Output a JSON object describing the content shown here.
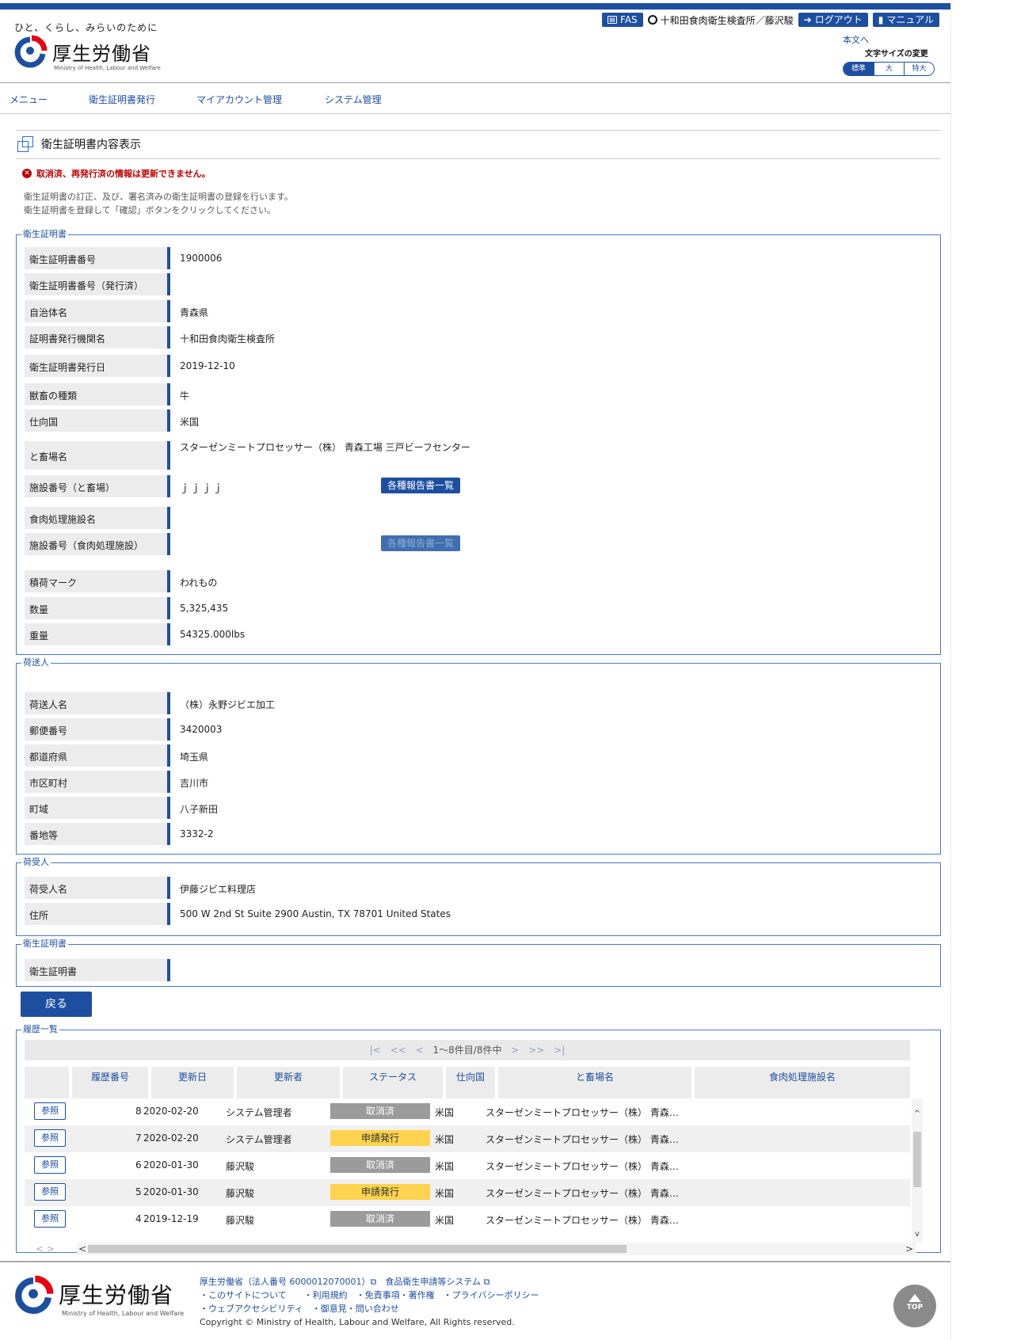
{
  "header": {
    "tagline": "ひと、くらし、みらいのために",
    "logo_name": "厚生労働省",
    "logo_en": "Ministry of Health, Labour and Welfare",
    "fas_label": "FAS",
    "user": "十和田食肉衛生検査所／藤沢駿",
    "logout_label": "ログアウト",
    "manual_label": "マニュアル",
    "skip_link": "本文へ",
    "font_size_label": "文字サイズの変更",
    "font_sizes": [
      "標準",
      "大",
      "特大"
    ]
  },
  "nav": [
    "メニュー",
    "衛生証明書発行",
    "マイアカウント管理",
    "システム管理"
  ],
  "page": {
    "title": "衛生証明書内容表示",
    "error": "取消済、再発行済の情報は更新できません。",
    "desc_1": "衛生証明書の訂正、及び、署名済みの衛生証明書の登録を行います。",
    "desc_2": "衛生証明書を登録して「確認」ボタンをクリックしてください。"
  },
  "cert": {
    "legend": "衛生証明書",
    "rows": [
      {
        "label": "衛生証明書番号",
        "value": "1900006"
      },
      {
        "label": "衛生証明書番号（発行済）",
        "value": ""
      },
      {
        "label": "自治体名",
        "value": "青森県"
      },
      {
        "label": "証明書発行機関名",
        "value": "十和田食肉衛生検査所"
      },
      {
        "label": "衛生証明書発行日",
        "value": "2019-12-10"
      },
      {
        "label": "獣畜の種類",
        "value": "牛"
      },
      {
        "label": "仕向国",
        "value": "米国"
      },
      {
        "label": "と畜場名",
        "value": "スターゼンミートプロセッサー（株） 青森工場 三戸ビーフセンター"
      },
      {
        "label": "施設番号（と畜場）",
        "value": "ｊｊｊｊ"
      },
      {
        "label": "食肉処理施設名",
        "value": ""
      },
      {
        "label": "施設番号（食肉処理施設）",
        "value": ""
      },
      {
        "label": "積荷マーク",
        "value": "われもの"
      },
      {
        "label": "数量",
        "value": "5,325,435"
      },
      {
        "label": "重量",
        "value": "54325.000lbs"
      }
    ],
    "report_btn": "各種報告書一覧"
  },
  "shipper": {
    "legend": "荷送人",
    "rows": [
      {
        "label": "荷送人名",
        "value": "（株）永野ジビエ加工"
      },
      {
        "label": "郵便番号",
        "value": "3420003"
      },
      {
        "label": "都道府県",
        "value": "埼玉県"
      },
      {
        "label": "市区町村",
        "value": "吉川市"
      },
      {
        "label": "町域",
        "value": "八子新田"
      },
      {
        "label": "番地等",
        "value": "3332-2"
      }
    ]
  },
  "consignee": {
    "legend": "荷受人",
    "rows": [
      {
        "label": "荷受人名",
        "value": "伊藤ジビエ料理店"
      },
      {
        "label": "住所",
        "value": "500 W 2nd St Suite 2900 Austin, TX 78701 United States"
      }
    ]
  },
  "cert_file": {
    "legend": "衛生証明書",
    "rows": [
      {
        "label": "衛生証明書",
        "value": ""
      }
    ]
  },
  "back_label": "戻る",
  "history": {
    "legend": "履歴一覧",
    "pager": {
      "first": "|<",
      "prev2": "<<",
      "prev": "<",
      "info": "1〜8件目/8件中",
      "next": ">",
      "next2": ">>",
      "last": ">|"
    },
    "columns": [
      "履歴番号",
      "更新日",
      "更新者",
      "ステータス",
      "仕向国",
      "と畜場名",
      "食肉処理施設名"
    ],
    "ref_label": "参照",
    "rows": [
      {
        "no": "8",
        "date": "2020-02-20",
        "user": "システム管理者",
        "status": "取消済",
        "status_type": "gray",
        "country": "米国",
        "plant": "スターゼンミートプロセッサー（株） 青森…"
      },
      {
        "no": "7",
        "date": "2020-02-20",
        "user": "システム管理者",
        "status": "申請発行",
        "status_type": "yellow",
        "country": "米国",
        "plant": "スターゼンミートプロセッサー（株） 青森…"
      },
      {
        "no": "6",
        "date": "2020-01-30",
        "user": "藤沢駿",
        "status": "取消済",
        "status_type": "gray",
        "country": "米国",
        "plant": "スターゼンミートプロセッサー（株） 青森…"
      },
      {
        "no": "5",
        "date": "2020-01-30",
        "user": "藤沢駿",
        "status": "申請発行",
        "status_type": "yellow",
        "country": "米国",
        "plant": "スターゼンミートプロセッサー（株） 青森…"
      },
      {
        "no": "4",
        "date": "2019-12-19",
        "user": "藤沢駿",
        "status": "取消済",
        "status_type": "gray",
        "country": "米国",
        "plant": "スターゼンミートプロセッサー（株） 青森…"
      }
    ]
  },
  "footer": {
    "logo_name": "厚生労働省",
    "logo_en": "Ministry of Health, Labour and Welfare",
    "line1": "厚生労働省（法人番号 6000012070001）⧉　食品衛生申請等システム ⧉",
    "line2": "・このサイトについて　　・利用規約　・免責事項・著作権　・プライバシーポリシー",
    "line3": "・ウェブアクセシビリティ　・御意見・問い合わせ",
    "copyright": "Copyright © Ministry of Health, Labour and Welfare, All Rights reserved.",
    "top_label": "TOP"
  },
  "colors": {
    "brand": "#1d4fa0",
    "error": "#c00000",
    "status_gray": "#9b9b9b",
    "status_yellow": "#ffd34d"
  }
}
